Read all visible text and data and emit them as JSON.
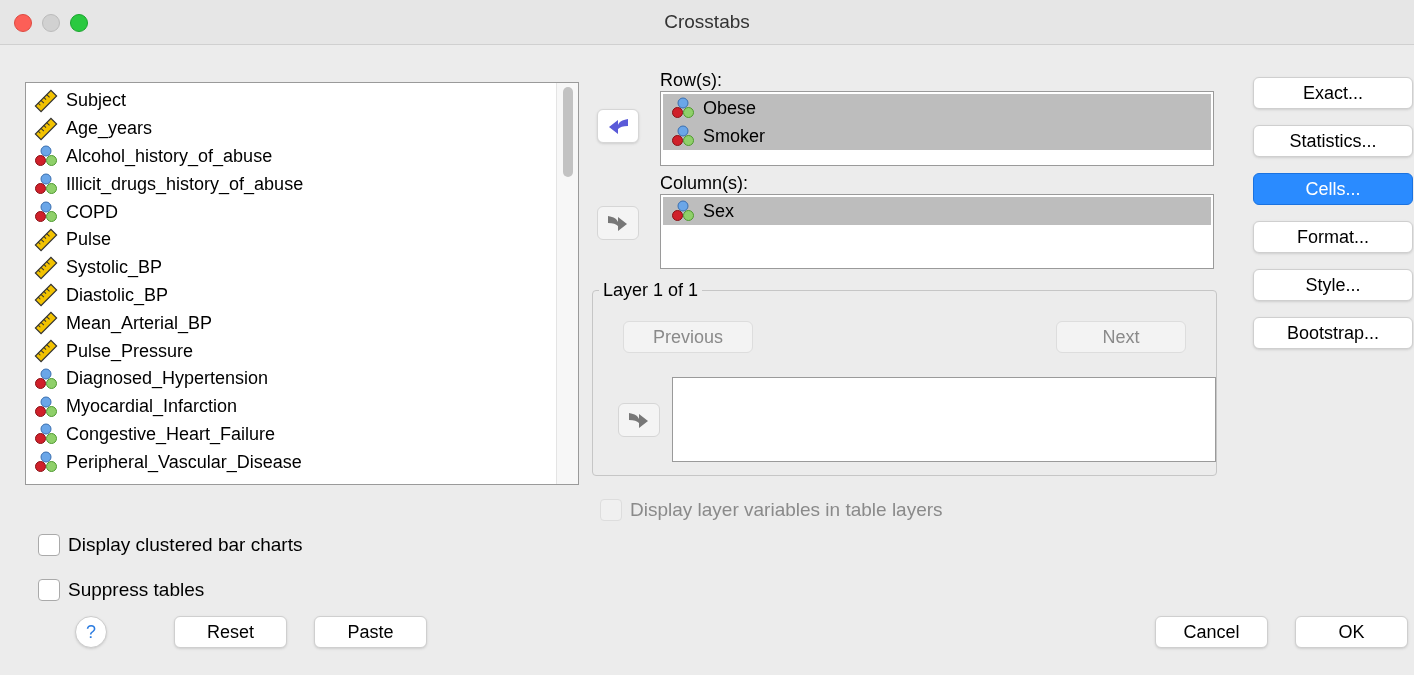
{
  "window": {
    "title": "Crosstabs"
  },
  "variables": [
    {
      "name": "Subject",
      "kind": "scale"
    },
    {
      "name": "Age_years",
      "kind": "scale"
    },
    {
      "name": "Alcohol_history_of_abuse",
      "kind": "nominal"
    },
    {
      "name": "Illicit_drugs_history_of_abuse",
      "kind": "nominal"
    },
    {
      "name": "COPD",
      "kind": "nominal"
    },
    {
      "name": "Pulse",
      "kind": "scale"
    },
    {
      "name": "Systolic_BP",
      "kind": "scale"
    },
    {
      "name": "Diastolic_BP",
      "kind": "scale"
    },
    {
      "name": "Mean_Arterial_BP",
      "kind": "scale"
    },
    {
      "name": "Pulse_Pressure",
      "kind": "scale"
    },
    {
      "name": "Diagnosed_Hypertension",
      "kind": "nominal"
    },
    {
      "name": "Myocardial_Infarction",
      "kind": "nominal"
    },
    {
      "name": "Congestive_Heart_Failure",
      "kind": "nominal"
    },
    {
      "name": "Peripheral_Vascular_Disease",
      "kind": "nominal"
    }
  ],
  "rows": {
    "label": "Row(s):",
    "arrow": {
      "kind": "left",
      "disabled": false
    },
    "items": [
      {
        "name": "Obese",
        "kind": "nominal",
        "selected": true
      },
      {
        "name": "Smoker",
        "kind": "nominal",
        "selected": true
      }
    ]
  },
  "columns": {
    "label": "Column(s):",
    "arrow": {
      "kind": "right",
      "disabled": true
    },
    "items": [
      {
        "name": "Sex",
        "kind": "nominal",
        "selected": true
      }
    ]
  },
  "layer": {
    "title": "Layer 1 of 1",
    "previous": {
      "label": "Previous",
      "disabled": true
    },
    "next": {
      "label": "Next",
      "disabled": true
    },
    "arrow": {
      "kind": "right",
      "disabled": true
    }
  },
  "layer_option": {
    "label": "Display layer variables in table layers",
    "checked": false,
    "disabled": true
  },
  "side_buttons": [
    {
      "label": "Exact...",
      "default": false
    },
    {
      "label": "Statistics...",
      "default": false
    },
    {
      "label": "Cells...",
      "default": true
    },
    {
      "label": "Format...",
      "default": false
    },
    {
      "label": "Style...",
      "default": false
    },
    {
      "label": "Bootstrap...",
      "default": false
    }
  ],
  "options": [
    {
      "label": "Display clustered bar charts",
      "checked": false
    },
    {
      "label": "Suppress tables",
      "checked": false
    }
  ],
  "footer": {
    "help": "?",
    "left_buttons": [
      "Reset",
      "Paste"
    ],
    "right_buttons": [
      "Cancel",
      "OK"
    ]
  }
}
